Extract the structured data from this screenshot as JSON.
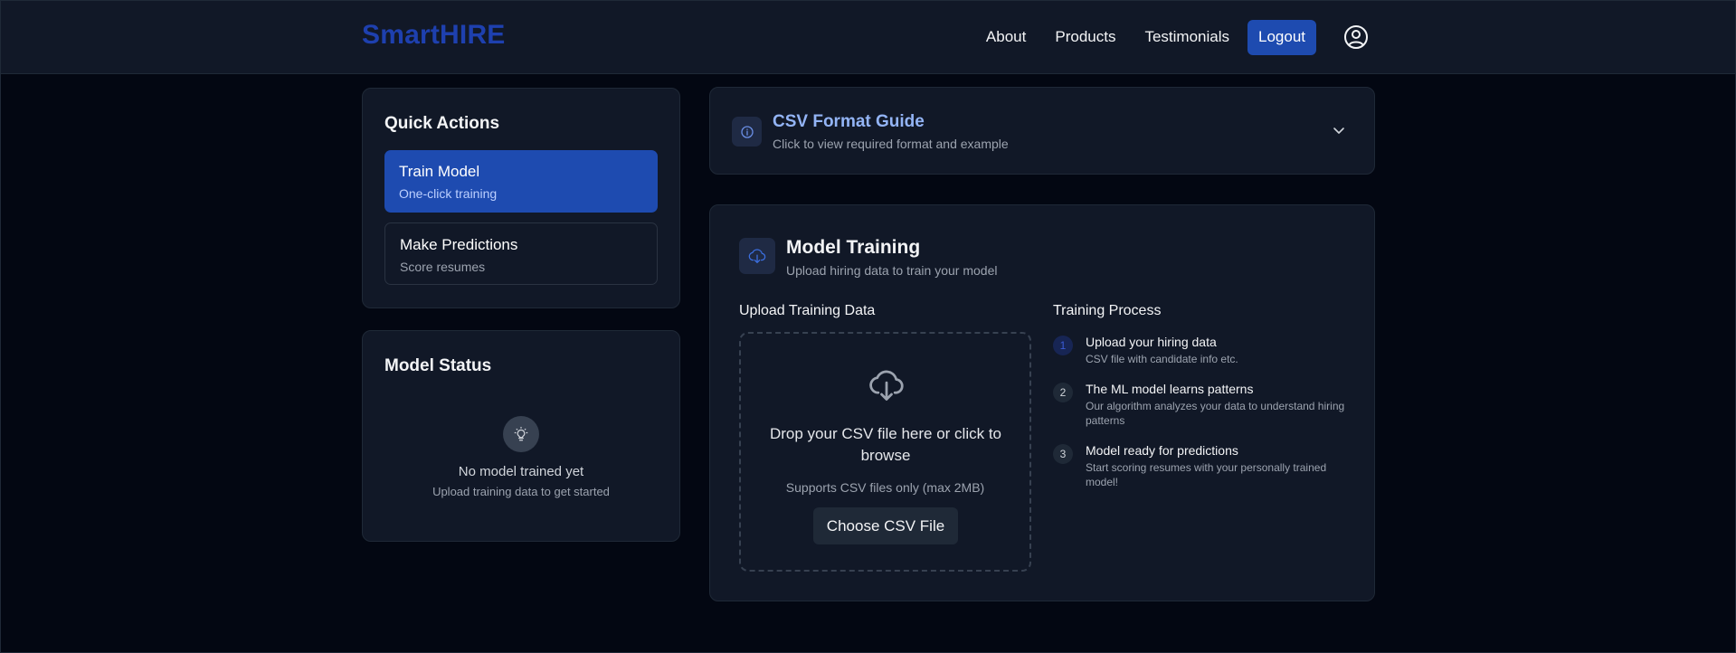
{
  "nav": {
    "brand_part1": "Smart",
    "brand_part2": "HIRE",
    "links": [
      "About",
      "Products",
      "Testimonials"
    ],
    "logout_label": "Logout"
  },
  "quick_actions": {
    "title": "Quick Actions",
    "items": [
      {
        "title": "Train Model",
        "subtitle": "One-click training"
      },
      {
        "title": "Make Predictions",
        "subtitle": "Score resumes"
      }
    ]
  },
  "model_status": {
    "title": "Model Status",
    "message": "No model trained yet",
    "hint": "Upload training data to get started"
  },
  "csv_guide": {
    "title": "CSV Format Guide",
    "subtitle": "Click to view required format and example"
  },
  "training": {
    "title": "Model Training",
    "subtitle": "Upload hiring data to train your model",
    "upload_heading": "Upload Training Data",
    "drop_text": "Drop your CSV file here or click to browse",
    "drop_hint": "Supports CSV files only (max 2MB)",
    "choose_label": "Choose CSV File",
    "process_heading": "Training Process",
    "steps": [
      {
        "num": "1",
        "title": "Upload your hiring data",
        "desc": "CSV file with candidate info etc."
      },
      {
        "num": "2",
        "title": "The ML model learns patterns",
        "desc": "Our algorithm analyzes your data to understand hiring patterns"
      },
      {
        "num": "3",
        "title": "Model ready for predictions",
        "desc": "Start scoring resumes with your personally trained model!"
      }
    ]
  },
  "colors": {
    "background": "#030712",
    "card": "#111827",
    "accent": "#1e4bb0",
    "brand": "#1e40af"
  }
}
